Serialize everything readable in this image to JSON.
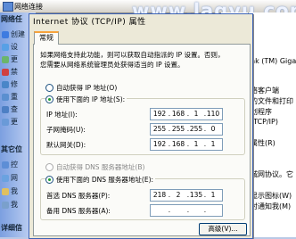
{
  "watermark": "www.lagyu.com",
  "explorer": {
    "title": "网络连接",
    "left_panel": {
      "task_head": "网络任",
      "tasks": [
        "创建",
        "设",
        "更",
        "禁",
        "修",
        "重",
        "查",
        "更"
      ],
      "other_head": "其它位",
      "others": [
        "控",
        "网",
        "我",
        "我"
      ],
      "details_head": "详细信"
    },
    "right_panel": {
      "lines": [
        "nk (TM) Gigab",
        "络客户端",
        "的文件和打印",
        "划程序",
        "(TCP/IP)",
        "属性(R)",
        "城网协议。它",
        "显示图标(W)",
        "时通知我(M)"
      ]
    }
  },
  "dialog": {
    "title": "Internet 协议 (TCP/IP) 属性",
    "tab": "常规",
    "desc_line1": "如果网络支持此功能，则可以获取自动指派的 IP 设置。否则，",
    "desc_line2": "您需要从网络系统管理员处获得适当的 IP 设置。",
    "auto_ip_label": "自动获得 IP 地址(O)",
    "manual_ip_label": "使用下面的 IP 地址(S):",
    "ip_label": "IP 地址(I):",
    "ip_value": [
      "192",
      "168",
      "1",
      "110"
    ],
    "mask_label": "子网掩码(U):",
    "mask_value": [
      "255",
      "255",
      "255",
      "0"
    ],
    "gateway_label": "默认网关(D):",
    "gateway_value": [
      "192",
      "168",
      "1",
      "1"
    ],
    "auto_dns_label": "自动获得 DNS 服务器地址(B)",
    "manual_dns_label": "使用下面的 DNS 服务器地址(E):",
    "dns1_label": "首选 DNS 服务器(P):",
    "dns1_value": [
      "218",
      "2",
      "135",
      "1"
    ],
    "dns2_label": "备用 DNS 服务器(A):",
    "dns2_value": [
      "",
      "",
      "",
      ""
    ],
    "advanced_button": "高级(V)..."
  }
}
